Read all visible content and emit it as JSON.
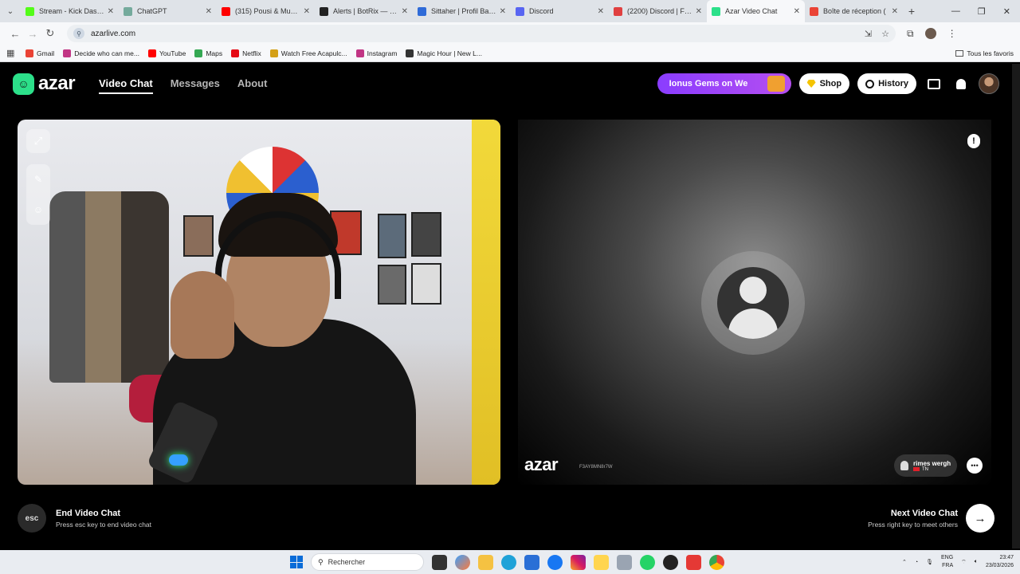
{
  "browser": {
    "tabs": [
      {
        "title": "Stream - Kick Dashbo",
        "color": "#53fc18",
        "active": false
      },
      {
        "title": "ChatGPT",
        "color": "#74aa9c",
        "active": false
      },
      {
        "title": "(315) Pousi & Muslin",
        "color": "#ff0000",
        "active": false
      },
      {
        "title": "Alerts | BotRix — Clo",
        "color": "#222222",
        "active": false
      },
      {
        "title": "Sittaher | Profil Bakch",
        "color": "#2f6bd8",
        "active": false
      },
      {
        "title": "Discord",
        "color": "#5865f2",
        "active": false
      },
      {
        "title": "(2200) Discord | Frier",
        "color": "#e04040",
        "active": false
      },
      {
        "title": "Azar Video Chat",
        "color": "#2ce08a",
        "active": true
      },
      {
        "title": "Boîte de réception (",
        "color": "#ea4335",
        "active": false
      }
    ],
    "url": "azarlive.com",
    "bookmarks": [
      {
        "label": "Gmail",
        "color": "#ea4335"
      },
      {
        "label": "Decide who can me...",
        "color": "#c13584"
      },
      {
        "label": "YouTube",
        "color": "#ff0000"
      },
      {
        "label": "Maps",
        "color": "#34a853"
      },
      {
        "label": "Netflix",
        "color": "#e50914"
      },
      {
        "label": "Watch Free Acapulc...",
        "color": "#d4a017"
      },
      {
        "label": "Instagram",
        "color": "#c13584"
      },
      {
        "label": "Magic Hour | New L...",
        "color": "#333333"
      }
    ],
    "all_bookmarks": "Tous les favoris"
  },
  "header": {
    "logo_text": "azar",
    "nav": [
      {
        "label": "Video Chat",
        "active": true
      },
      {
        "label": "Messages",
        "active": false
      },
      {
        "label": "About",
        "active": false
      }
    ],
    "promo_text": "Ionus Gems on We",
    "shop_label": "Shop",
    "history_label": "History"
  },
  "peer": {
    "watermark_logo": "azar",
    "watermark_id": "F3AY8MN8r7W",
    "name": "rimes wergh",
    "country": "TN"
  },
  "controls": {
    "end": {
      "key": "esc",
      "title": "End Video Chat",
      "subtitle": "Press esc key to end video chat"
    },
    "next": {
      "title": "Next Video Chat",
      "subtitle": "Press right key to meet others"
    }
  },
  "taskbar": {
    "search_placeholder": "Rechercher",
    "lang_top": "ENG",
    "lang_bottom": "FRA",
    "time": "23:47",
    "date": "23/03/2026"
  },
  "colors": {
    "brand": "#2ce08a",
    "promo": "#8a3dff"
  }
}
